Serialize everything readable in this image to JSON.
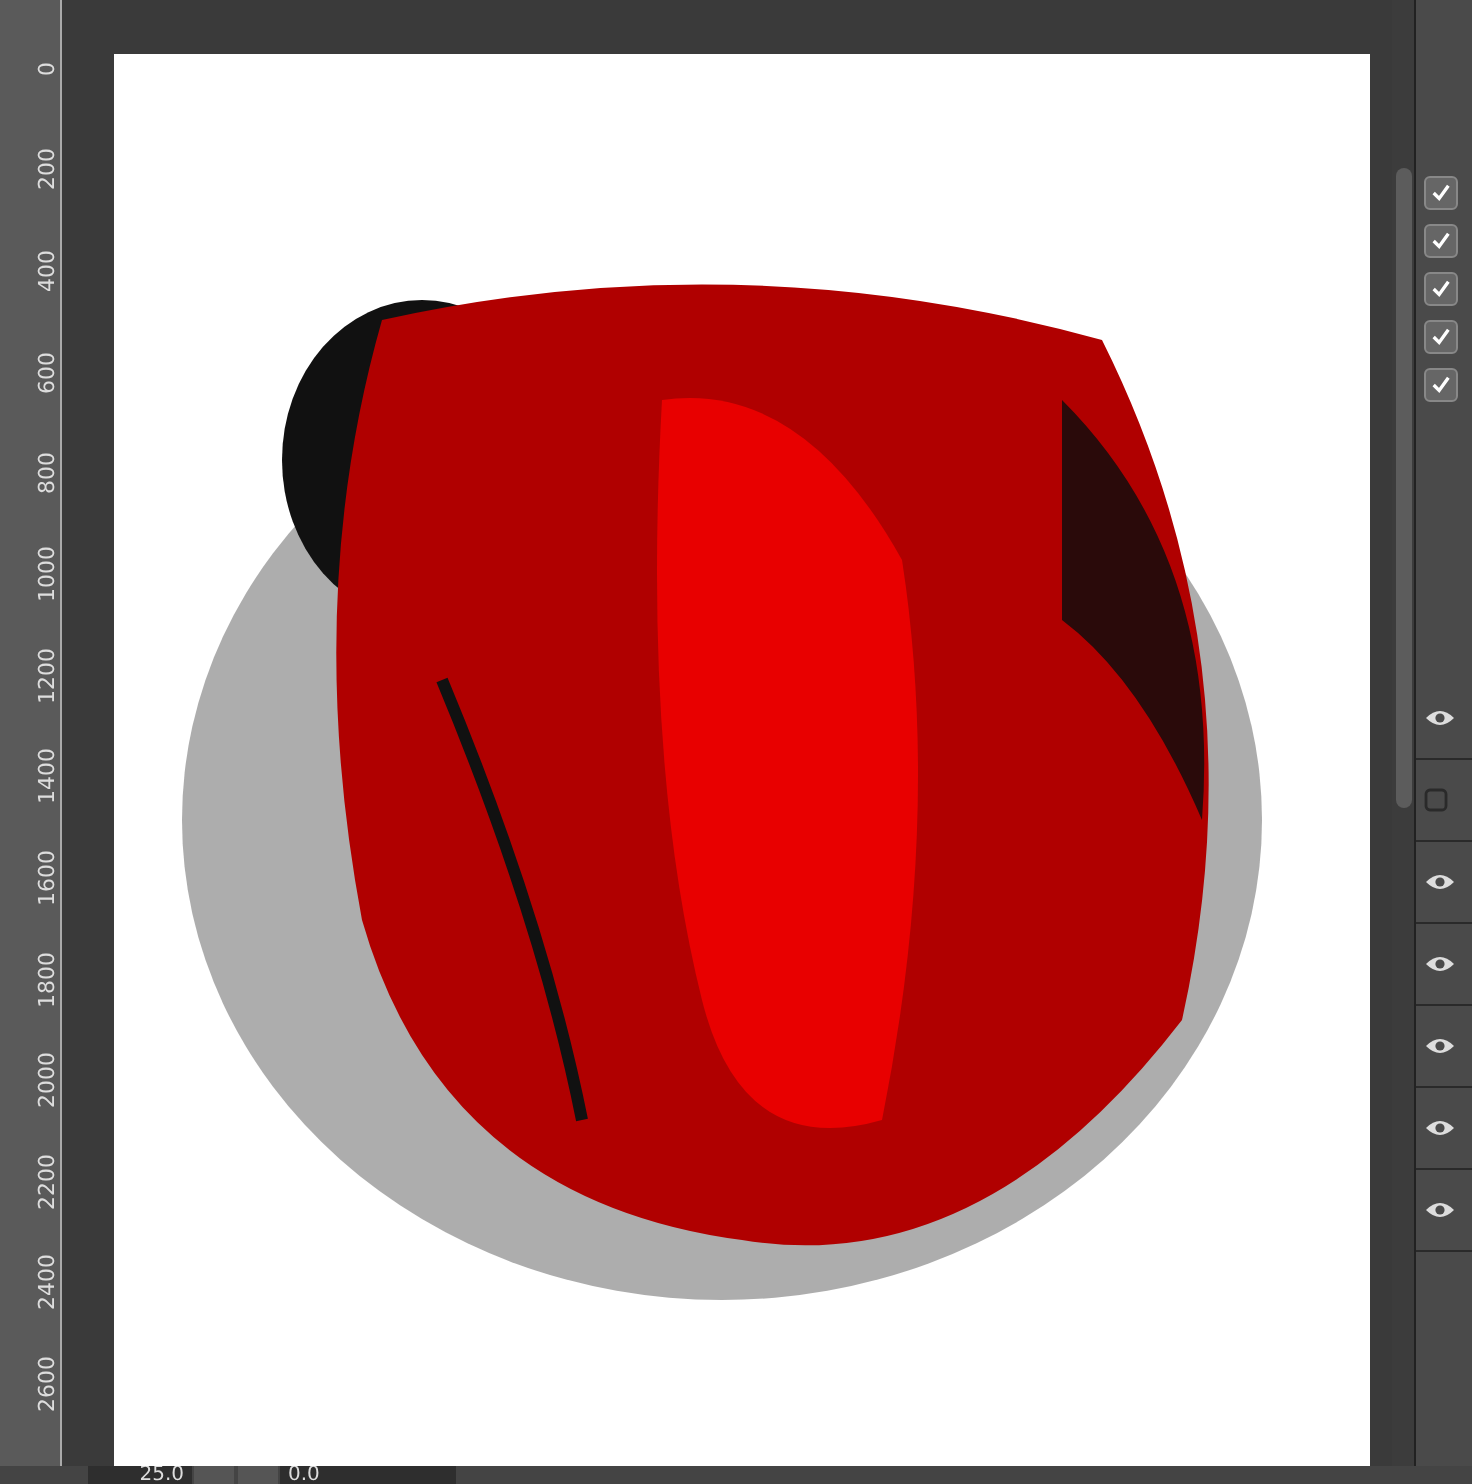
{
  "ruler": {
    "ticks": [
      "0",
      "200",
      "400",
      "600",
      "800",
      "1000",
      "1200",
      "1400",
      "1600",
      "1800",
      "2000",
      "2200",
      "2400",
      "2600"
    ]
  },
  "panel": {
    "checkboxes": [
      {
        "checked": true
      },
      {
        "checked": true
      },
      {
        "checked": true
      },
      {
        "checked": true
      },
      {
        "checked": true
      }
    ],
    "layers": [
      {
        "visible": true
      },
      {
        "visible": false
      },
      {
        "visible": true
      },
      {
        "visible": true
      },
      {
        "visible": true
      },
      {
        "visible": true
      },
      {
        "visible": true
      }
    ]
  },
  "bottom_bar": {
    "zoom": "25.0",
    "angle": "0.0"
  }
}
